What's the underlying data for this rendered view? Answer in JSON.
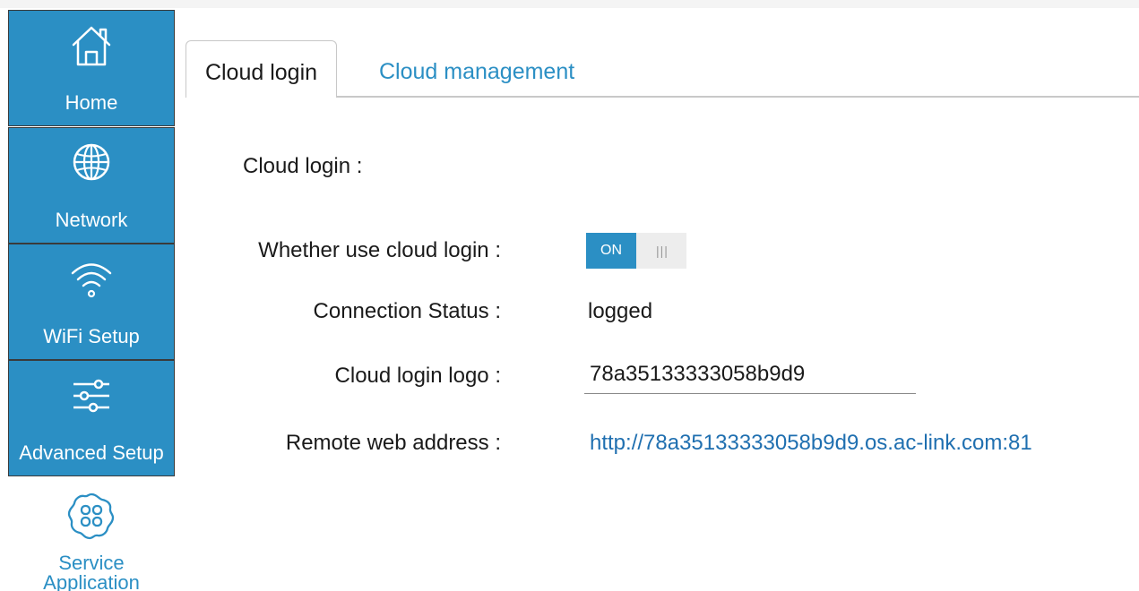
{
  "sidebar": {
    "items": [
      {
        "label": "Home",
        "icon": "home-icon"
      },
      {
        "label": "Network",
        "icon": "globe-icon"
      },
      {
        "label": "WiFi Setup",
        "icon": "wifi-icon"
      },
      {
        "label": "Advanced Setup",
        "icon": "sliders-icon"
      },
      {
        "label_line1": "Service",
        "label_line2": "Application",
        "icon": "apps-icon",
        "active": true
      }
    ],
    "accent_color": "#2b8fc4"
  },
  "tabs": [
    {
      "label": "Cloud login",
      "active": true
    },
    {
      "label": "Cloud management",
      "active": false
    }
  ],
  "content": {
    "section_title": "Cloud login :",
    "fields": {
      "use_cloud_login_label": "Whether use cloud login :",
      "toggle_on_label": "ON",
      "toggle_state": true,
      "connection_status_label": "Connection Status :",
      "connection_status_value": "logged",
      "cloud_logo_label": "Cloud login logo :",
      "cloud_logo_value": "78a35133333058b9d9",
      "remote_address_label": "Remote web address :",
      "remote_address_value": "http://78a35133333058b9d9.os.ac-link.com:81"
    }
  }
}
